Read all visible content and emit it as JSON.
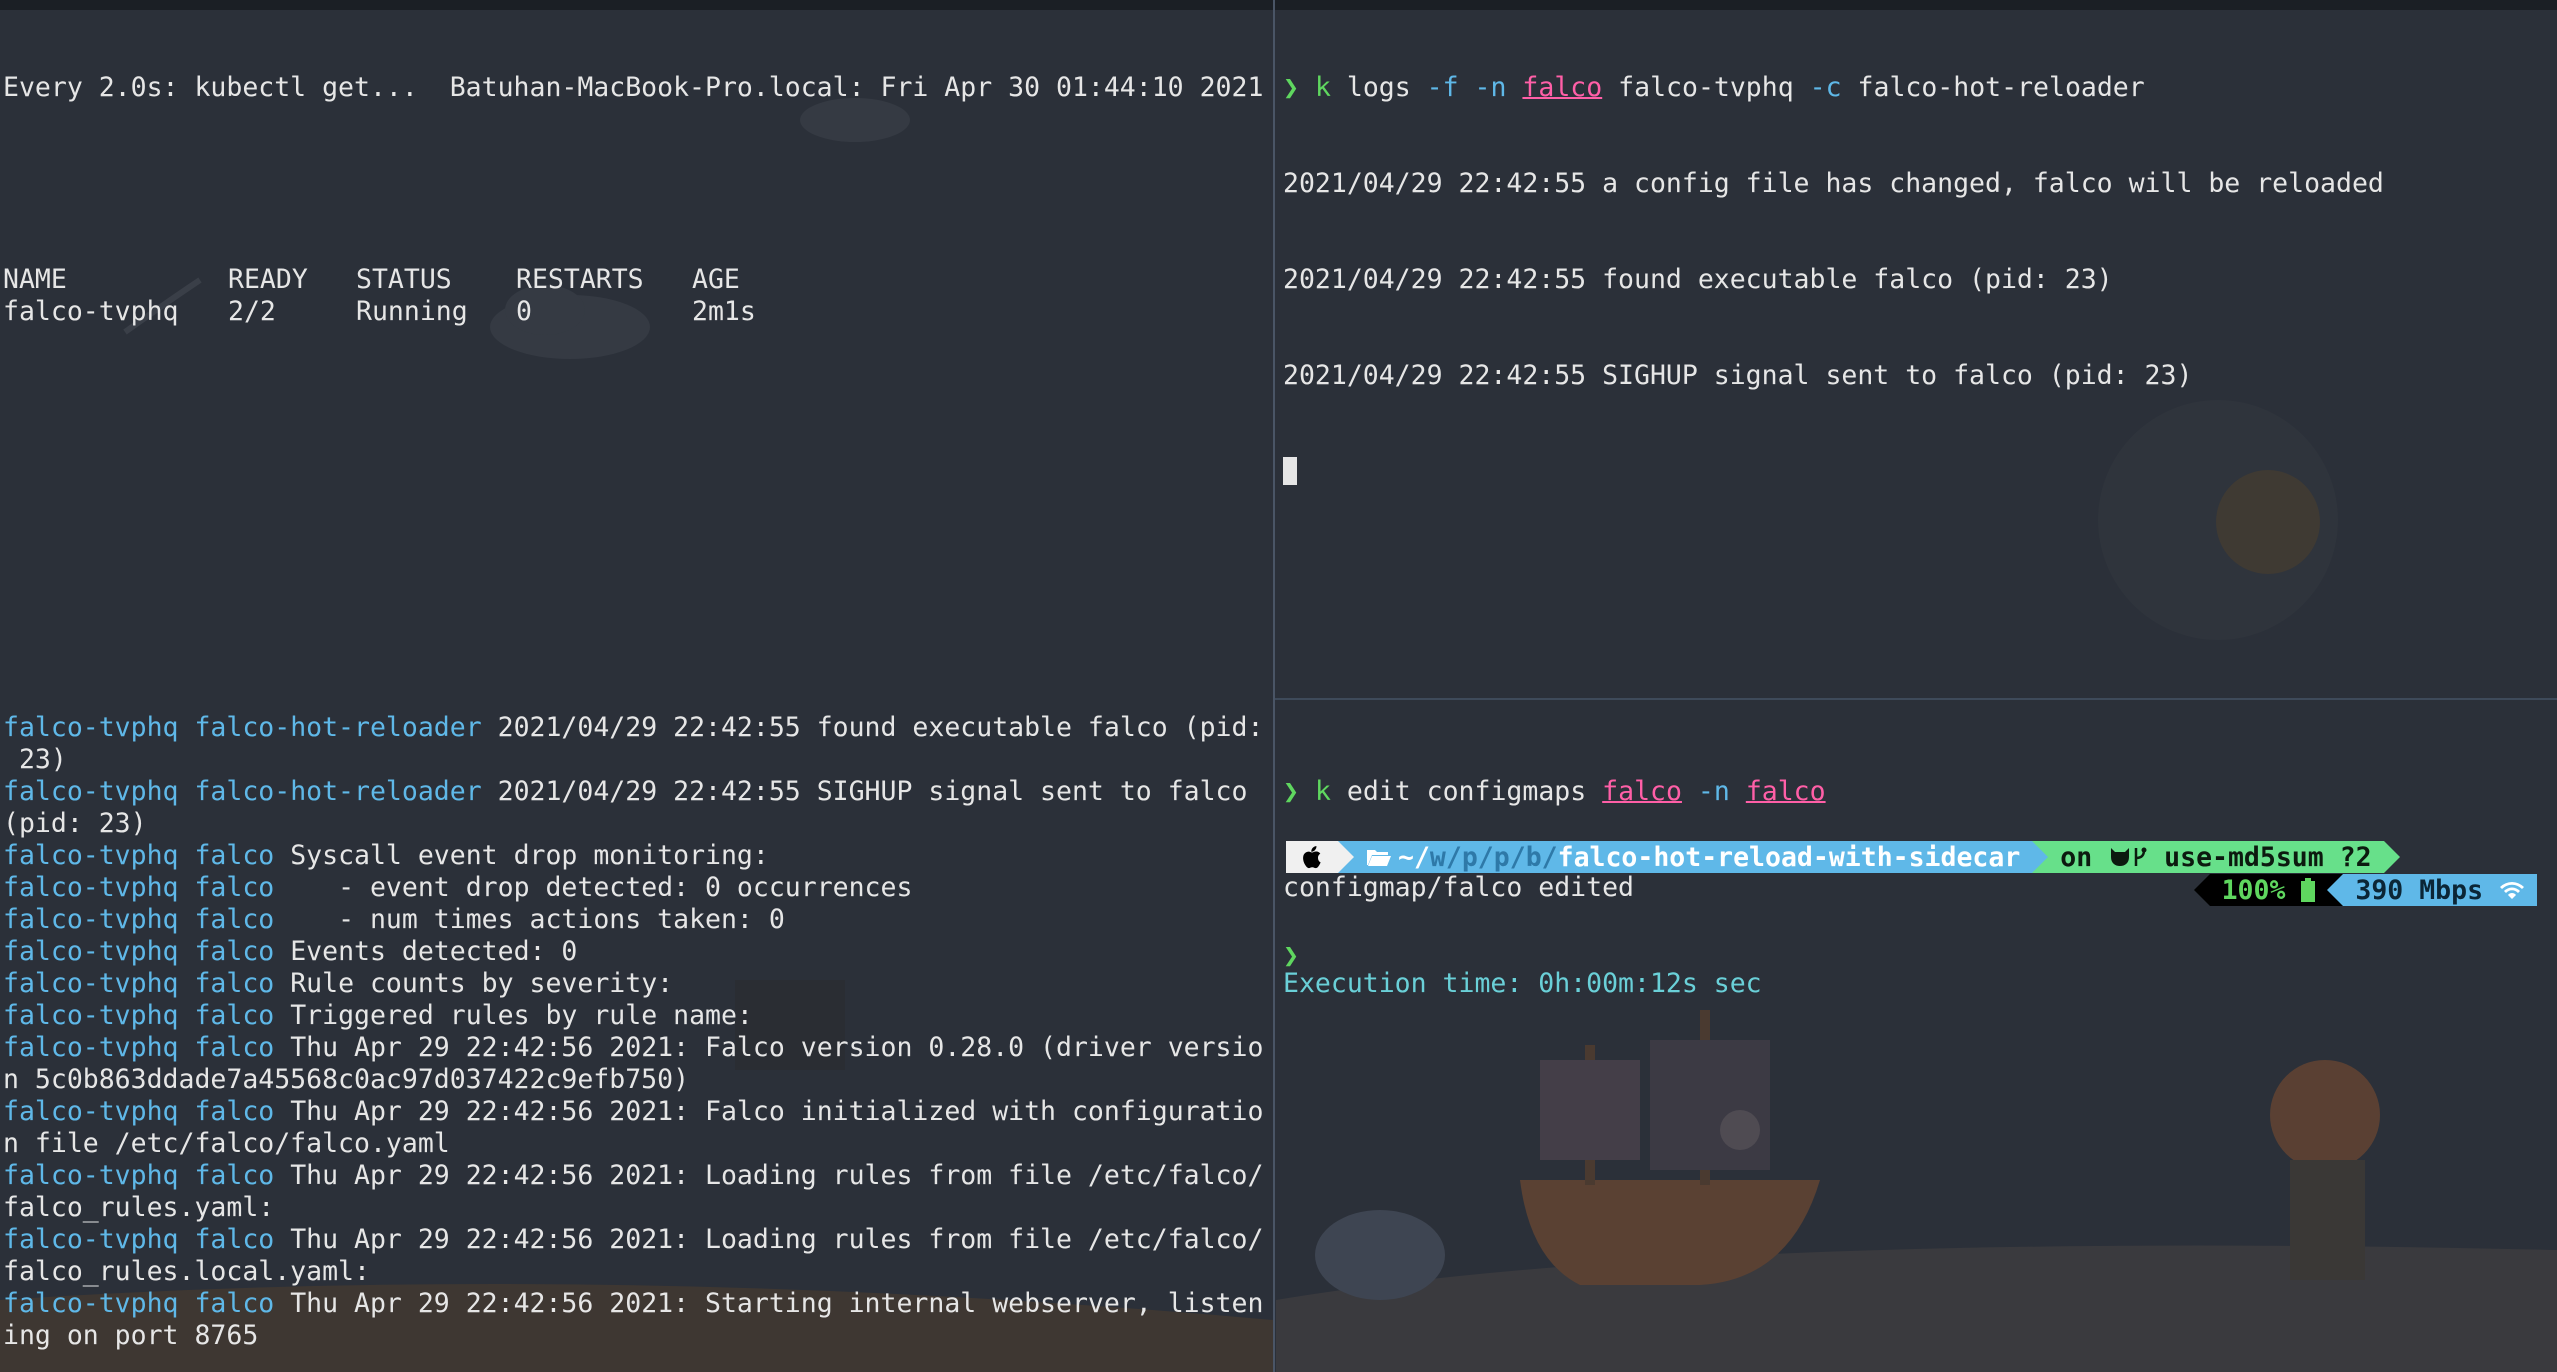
{
  "watch_pane": {
    "header": "Every 2.0s: kubectl get...  Batuhan-MacBook-Pro.local: Fri Apr 30 01:44:10 2021",
    "columns": [
      "NAME",
      "READY",
      "STATUS",
      "RESTARTS",
      "AGE"
    ],
    "rows": [
      [
        "falco-tvphq",
        "2/2",
        "Running",
        "0",
        "2m1s"
      ]
    ]
  },
  "logs_pane": {
    "prompt_symbol": "❯",
    "cmd_k": "k",
    "cmd_part1": "logs",
    "cmd_part2": "-f -n",
    "cmd_ns": "falco",
    "cmd_part3": "falco-tvphq",
    "cmd_part4": "-c",
    "cmd_part5": "falco-hot-reloader",
    "lines": [
      "2021/04/29 22:42:55 a config file has changed, falco will be reloaded",
      "2021/04/29 22:42:55 found executable falco (pid: 23)",
      "2021/04/29 22:42:55 SIGHUP signal sent to falco (pid: 23)"
    ]
  },
  "stream_pane": {
    "lines": [
      {
        "pod": "falco-tvphq",
        "container": "falco-hot-reloader",
        "text": " 2021/04/29 22:42:55 found executable falco (pid:"
      },
      {
        "pod": "",
        "container": "",
        "text": " 23)"
      },
      {
        "pod": "falco-tvphq",
        "container": "falco-hot-reloader",
        "text": " 2021/04/29 22:42:55 SIGHUP signal sent to falco"
      },
      {
        "pod": "",
        "container": "",
        "text": "(pid: 23)"
      },
      {
        "pod": "falco-tvphq",
        "container": "falco",
        "text": " Syscall event drop monitoring:"
      },
      {
        "pod": "falco-tvphq",
        "container": "falco",
        "text": "    - event drop detected: 0 occurrences"
      },
      {
        "pod": "falco-tvphq",
        "container": "falco",
        "text": "    - num times actions taken: 0"
      },
      {
        "pod": "falco-tvphq",
        "container": "falco",
        "text": " Events detected: 0"
      },
      {
        "pod": "falco-tvphq",
        "container": "falco",
        "text": " Rule counts by severity:"
      },
      {
        "pod": "falco-tvphq",
        "container": "falco",
        "text": " Triggered rules by rule name:"
      },
      {
        "pod": "falco-tvphq",
        "container": "falco",
        "text": " Thu Apr 29 22:42:56 2021: Falco version 0.28.0 (driver versio"
      },
      {
        "pod": "",
        "container": "",
        "text": "n 5c0b863ddade7a45568c0ac97d037422c9efb750)"
      },
      {
        "pod": "falco-tvphq",
        "container": "falco",
        "text": " Thu Apr 29 22:42:56 2021: Falco initialized with configuratio"
      },
      {
        "pod": "",
        "container": "",
        "text": "n file /etc/falco/falco.yaml"
      },
      {
        "pod": "falco-tvphq",
        "container": "falco",
        "text": " Thu Apr 29 22:42:56 2021: Loading rules from file /etc/falco/"
      },
      {
        "pod": "",
        "container": "",
        "text": "falco_rules.yaml:"
      },
      {
        "pod": "falco-tvphq",
        "container": "falco",
        "text": " Thu Apr 29 22:42:56 2021: Loading rules from file /etc/falco/"
      },
      {
        "pod": "",
        "container": "",
        "text": "falco_rules.local.yaml:"
      },
      {
        "pod": "falco-tvphq",
        "container": "falco",
        "text": " Thu Apr 29 22:42:56 2021: Starting internal webserver, listen"
      },
      {
        "pod": "",
        "container": "",
        "text": "ing on port 8765"
      }
    ]
  },
  "edit_pane": {
    "prompt_symbol": "❯",
    "cmd_k": "k",
    "cmd_part1": "edit configmaps",
    "cmd_name": "falco",
    "cmd_flag": "-n",
    "cmd_ns": "falco",
    "output": "configmap/falco edited",
    "exec_time": "Execution time: 0h:00m:12s sec",
    "prompt": {
      "apple_icon": "apple-icon",
      "folder_icon": "folder-open-icon",
      "path_home": "~/",
      "path_dims": [
        "w/",
        "p/",
        "p/",
        "b/"
      ],
      "path_dir": "falco-hot-reload-with-sidecar",
      "git_on": "on",
      "git_icons": "github-cat-icon branch-icon",
      "git_branch": "use-md5sum ?2",
      "battery": "100%",
      "network": "390 Mbps"
    },
    "input_prompt": "❯"
  },
  "colors": {
    "background": "#2b3039",
    "green": "#5fd75f",
    "pink": "#ff5fa7",
    "cyan": "#5fb8e8",
    "prompt_path_bg": "#5fb8e8",
    "prompt_git_bg": "#67e08a"
  }
}
